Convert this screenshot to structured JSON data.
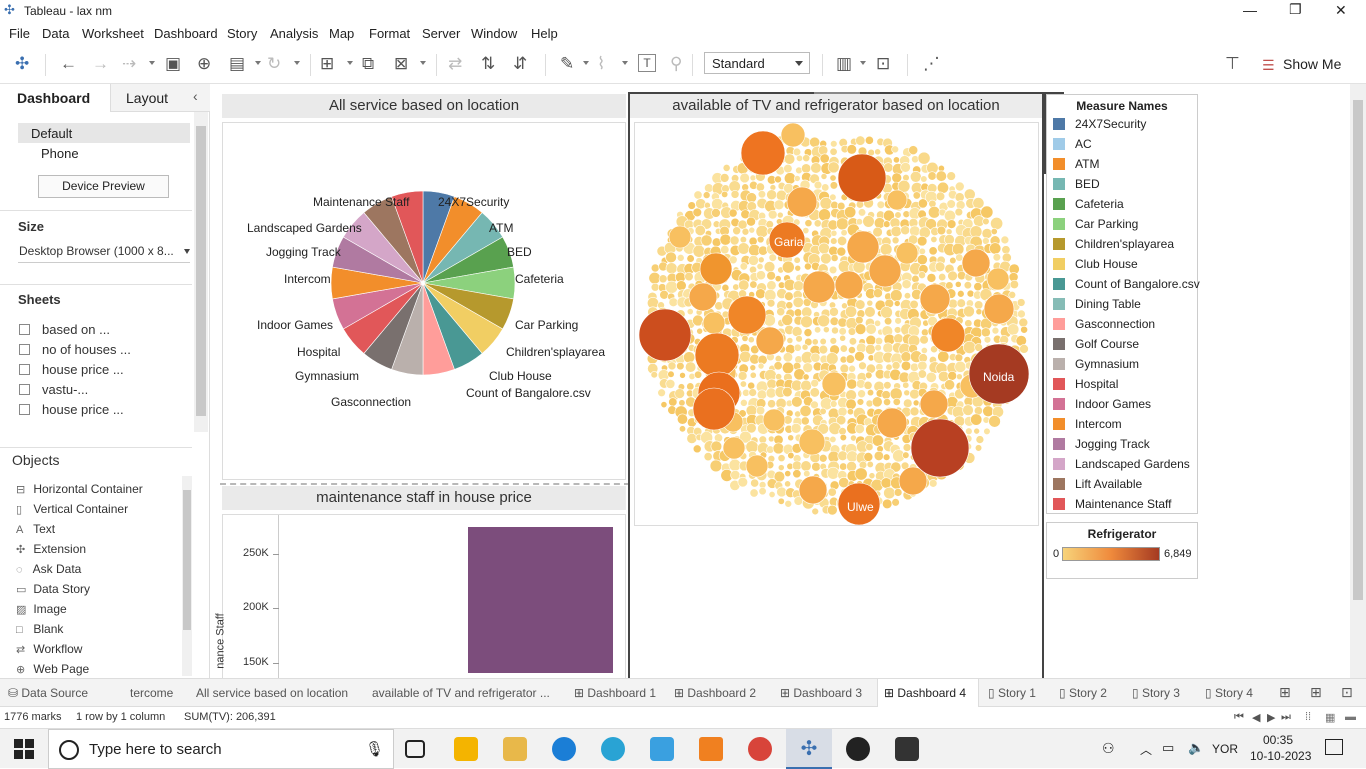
{
  "window": {
    "title": "Tableau - lax nm"
  },
  "menu": [
    "File",
    "Data",
    "Worksheet",
    "Dashboard",
    "Story",
    "Analysis",
    "Map",
    "Format",
    "Server",
    "Window",
    "Help"
  ],
  "toolbar": {
    "view_mode": "Standard",
    "show_me": "Show Me"
  },
  "left_panel": {
    "tabs": [
      "Dashboard",
      "Layout"
    ],
    "devices": [
      "Default",
      "Phone"
    ],
    "device_preview": "Device Preview",
    "size_label": "Size",
    "size_value": "Desktop Browser (1000 x 8...",
    "sheets_label": "Sheets",
    "sheets": [
      "based on ...",
      "no of houses ...",
      "house price ...",
      "vastu-...",
      "house price ..."
    ],
    "objects_label": "Objects",
    "objects": [
      {
        "icon": "horizontal-container-icon",
        "glyph": "⊟",
        "label": "Horizontal Container"
      },
      {
        "icon": "vertical-container-icon",
        "glyph": "▯",
        "label": "Vertical Container"
      },
      {
        "icon": "text-icon",
        "glyph": "A",
        "label": "Text"
      },
      {
        "icon": "extension-icon",
        "glyph": "✣",
        "label": "Extension"
      },
      {
        "icon": "ask-data-icon",
        "glyph": "◌",
        "label": "Ask Data"
      },
      {
        "icon": "data-story-icon",
        "glyph": "▭",
        "label": "Data Story"
      },
      {
        "icon": "image-icon",
        "glyph": "▨",
        "label": "Image"
      },
      {
        "icon": "blank-icon",
        "glyph": "□",
        "label": "Blank"
      },
      {
        "icon": "workflow-icon",
        "glyph": "⇄",
        "label": "Workflow"
      },
      {
        "icon": "web-page-icon",
        "glyph": "⊕",
        "label": "Web Page"
      }
    ]
  },
  "pie_zone": {
    "title": "All service based on location",
    "labels": [
      "24X7Security",
      "ATM",
      "BED",
      "Cafeteria",
      "Car Parking",
      "Children'splayarea",
      "Club House",
      "Count of Bangalore.csv",
      "Gasconnection",
      "Gymnasium",
      "Hospital",
      "Indoor Games",
      "Intercom",
      "Jogging Track",
      "Landscaped Gardens",
      "Maintenance Staff"
    ]
  },
  "bubble_zone": {
    "title": "available of TV and refrigerator based on location",
    "labels": [
      "Garia",
      "Noida",
      "Ulwe"
    ]
  },
  "bar_zone": {
    "title": "maintenance staff in house price",
    "y_axis_label": "nance Staff",
    "ticks": [
      "250K",
      "200K",
      "150K"
    ]
  },
  "legend": {
    "title": "Measure Names",
    "items": [
      {
        "name": "24X7Security",
        "color": "#4e79a7"
      },
      {
        "name": "AC",
        "color": "#a0cbe8"
      },
      {
        "name": "ATM",
        "color": "#f28e2b"
      },
      {
        "name": "BED",
        "color": "#76b7b2"
      },
      {
        "name": "Cafeteria",
        "color": "#59a14f"
      },
      {
        "name": "Car Parking",
        "color": "#8cd17d"
      },
      {
        "name": "Children'splayarea",
        "color": "#b6992d"
      },
      {
        "name": "Club House",
        "color": "#f1ce63"
      },
      {
        "name": "Count of Bangalore.csv",
        "color": "#499894"
      },
      {
        "name": "Dining Table",
        "color": "#86bcb6"
      },
      {
        "name": "Gasconnection",
        "color": "#ff9d9a"
      },
      {
        "name": "Golf Course",
        "color": "#79706e"
      },
      {
        "name": "Gymnasium",
        "color": "#bab0ac"
      },
      {
        "name": "Hospital",
        "color": "#e15759"
      },
      {
        "name": "Indoor Games",
        "color": "#d37295"
      },
      {
        "name": "Intercom",
        "color": "#f28e2b"
      },
      {
        "name": "Jogging Track",
        "color": "#b07aa1"
      },
      {
        "name": "Landscaped Gardens",
        "color": "#d4a6c8"
      },
      {
        "name": "Lift Available",
        "color": "#9d7660"
      },
      {
        "name": "Maintenance Staff",
        "color": "#e15759"
      }
    ]
  },
  "refrigerator_legend": {
    "title": "Refrigerator",
    "min": "0",
    "max": "6,849",
    "color_low": "#f7d37a",
    "color_high": "#a53a22"
  },
  "tabs": [
    "Data Source",
    "tercome",
    "All service based on location",
    "available of TV and refrigerator ...",
    "Dashboard 1",
    "Dashboard 2",
    "Dashboard 3",
    "Dashboard 4",
    "Story 1",
    "Story 2",
    "Story 3",
    "Story 4"
  ],
  "status": {
    "marks": "1776 marks",
    "rows": "1 row by 1 column",
    "sum": "SUM(TV): 206,391"
  },
  "taskbar": {
    "search_placeholder": "Type here to search",
    "lang": "YOR",
    "time": "00:35",
    "date": "10-10-2023"
  }
}
